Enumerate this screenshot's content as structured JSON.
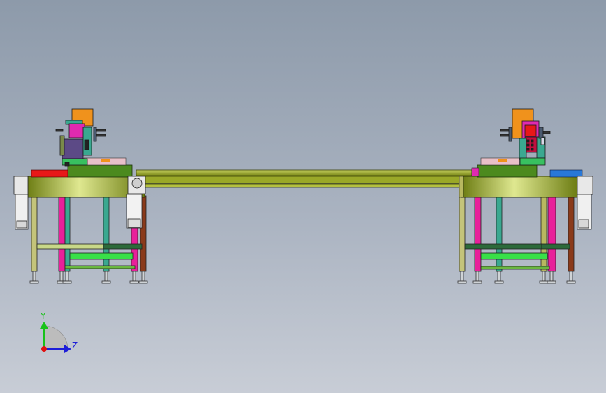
{
  "triad": {
    "y_label": "Y",
    "z_label": "Z",
    "colors": {
      "y_axis": "#19c219",
      "z_axis": "#1d1dd8",
      "origin": "#e01010"
    }
  },
  "colors": {
    "frame": "#8a9a20",
    "frame_light": "#c8d860",
    "rail": "#9aa828",
    "leg_yellow": "#b8b860",
    "leg_magenta": "#e8209a",
    "leg_teal": "#3aa890",
    "leg_brown": "#8a3a1a",
    "brace_green": "#38e048",
    "orange_block": "#f0921c",
    "purple_block": "#5c4a86",
    "pink_block": "#e02ab0",
    "red_block": "#e81818",
    "blue_block": "#2878d8",
    "motor": "#e8e8e8"
  },
  "scene": {
    "left_station": "left-workstation",
    "right_station": "right-workstation",
    "beam": "connecting-rail-beam"
  }
}
